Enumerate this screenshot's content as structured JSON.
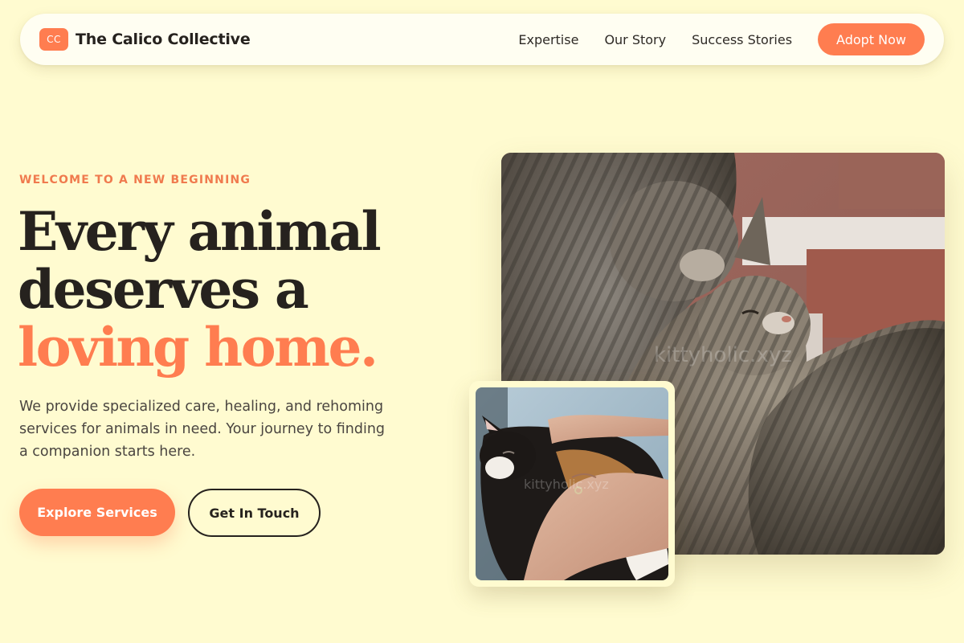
{
  "nav": {
    "logo_text": "CC",
    "brand_name": "The Calico Collective",
    "links": [
      "Expertise",
      "Our Story",
      "Success Stories"
    ],
    "cta_label": "Adopt Now"
  },
  "hero": {
    "eyebrow": "WELCOME TO A NEW BEGINNING",
    "headline_line1": "Every animal",
    "headline_line2": "deserves a",
    "headline_accent": "loving home.",
    "description": "We provide specialized care, healing, and rehoming services for animals in need. Your journey to finding a companion starts here.",
    "primary_cta": "Explore Services",
    "secondary_cta": "Get In Touch"
  },
  "images": {
    "main_alt": "Two tabby cats nuzzling",
    "small_alt": "Calico cat being petted in a person's arms",
    "watermark": "kittyholic.xyz"
  },
  "colors": {
    "background": "#fffbd0",
    "accent": "#ff7d50",
    "text_dark": "#26221e"
  }
}
